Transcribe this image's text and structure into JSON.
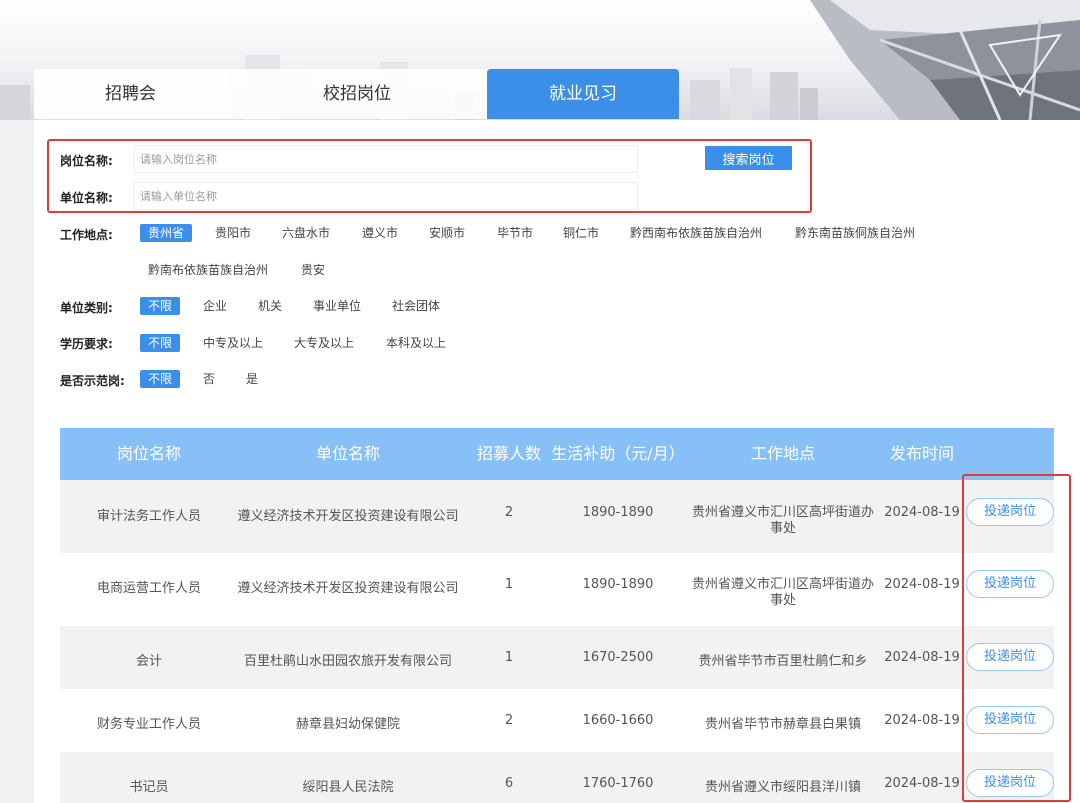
{
  "tabs": [
    {
      "label": "招聘会",
      "active": false
    },
    {
      "label": "校招岗位",
      "active": false
    },
    {
      "label": "就业见习",
      "active": true
    }
  ],
  "search": {
    "position_label": "岗位名称:",
    "position_placeholder": "请输入岗位名称",
    "unit_label": "单位名称:",
    "unit_placeholder": "请输入单位名称",
    "button_label": "搜索岗位"
  },
  "filters": {
    "location": {
      "label": "工作地点:",
      "options": [
        "贵州省",
        "贵阳市",
        "六盘水市",
        "遵义市",
        "安顺市",
        "毕节市",
        "铜仁市",
        "黔西南布依族苗族自治州",
        "黔东南苗族侗族自治州",
        "黔南布依族苗族自治州",
        "贵安"
      ],
      "selected": "贵州省"
    },
    "unit_type": {
      "label": "单位类别:",
      "options": [
        "不限",
        "企业",
        "机关",
        "事业单位",
        "社会团体"
      ],
      "selected": "不限"
    },
    "education": {
      "label": "学历要求:",
      "options": [
        "不限",
        "中专及以上",
        "大专及以上",
        "本科及以上"
      ],
      "selected": "不限"
    },
    "demo": {
      "label": "是否示范岗:",
      "options": [
        "不限",
        "否",
        "是"
      ],
      "selected": "不限"
    }
  },
  "table": {
    "headers": [
      "岗位名称",
      "单位名称",
      "招募人数",
      "生活补助（元/月）",
      "工作地点",
      "发布时间"
    ],
    "apply_label": "投递岗位",
    "rows": [
      {
        "position": "审计法务工作人员",
        "unit": "遵义经济技术开发区投资建设有限公司",
        "count": "2",
        "subsidy": "1890-1890",
        "location": "贵州省遵义市汇川区高坪街道办事处",
        "date": "2024-08-19"
      },
      {
        "position": "电商运营工作人员",
        "unit": "遵义经济技术开发区投资建设有限公司",
        "count": "1",
        "subsidy": "1890-1890",
        "location": "贵州省遵义市汇川区高坪街道办事处",
        "date": "2024-08-19"
      },
      {
        "position": "会计",
        "unit": "百里杜鹃山水田园农旅开发有限公司",
        "count": "1",
        "subsidy": "1670-2500",
        "location": "贵州省毕节市百里杜鹃仁和乡",
        "date": "2024-08-19"
      },
      {
        "position": "财务专业工作人员",
        "unit": "赫章县妇幼保健院",
        "count": "2",
        "subsidy": "1660-1660",
        "location": "贵州省毕节市赫章县白果镇",
        "date": "2024-08-19"
      },
      {
        "position": "书记员",
        "unit": "绥阳县人民法院",
        "count": "6",
        "subsidy": "1760-1760",
        "location": "贵州省遵义市绥阳县洋川镇",
        "date": "2024-08-19"
      }
    ]
  },
  "colors": {
    "accent": "#3c8fe8",
    "table_header": "#87c0f6",
    "highlight_red": "#e03a3a"
  }
}
